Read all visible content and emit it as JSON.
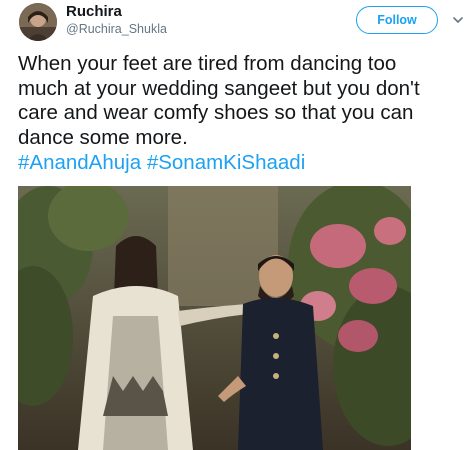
{
  "user": {
    "name": "Ruchira",
    "handle": "@Ruchira_Shukla"
  },
  "actions": {
    "follow_label": "Follow"
  },
  "tweet": {
    "text_lines": [
      "When your feet are tired from dancing too",
      "much at your wedding sangeet but you don't",
      "care and wear comfy shoes so that you can",
      "dance some more."
    ],
    "hashtags": [
      "#AnandAhuja",
      "#SonamKiShaadi"
    ]
  },
  "colors": {
    "accent": "#1da1f2",
    "text": "#14171a",
    "muted": "#657786"
  },
  "icons": {
    "more": "chevron-down-icon"
  }
}
